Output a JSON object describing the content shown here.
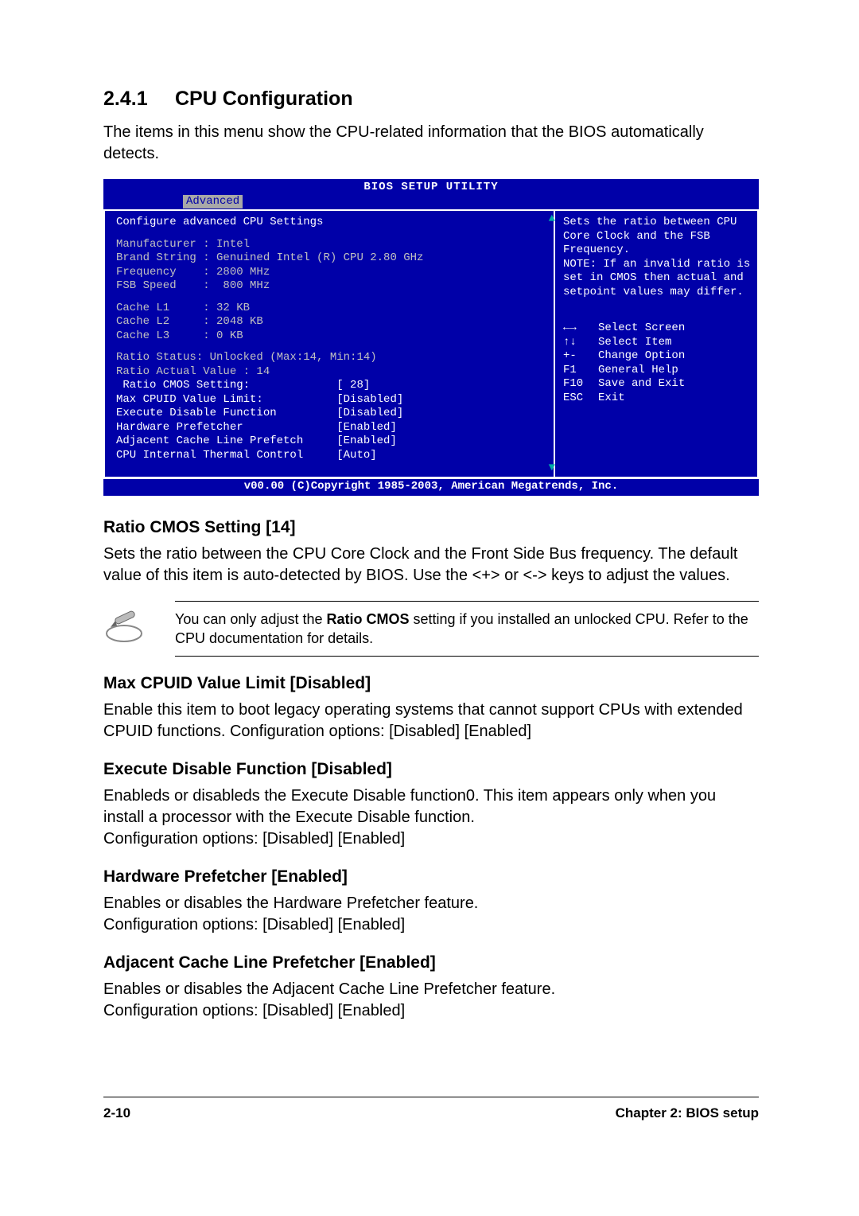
{
  "section": {
    "number": "2.4.1",
    "title": "CPU Configuration"
  },
  "intro": "The items in this menu show the CPU-related information that the BIOS automatically detects.",
  "bios": {
    "title": "BIOS SETUP UTILITY",
    "active_tab": "Advanced",
    "main_heading": "Configure advanced CPU Settings",
    "info": {
      "manufacturer": "Manufacturer : Intel",
      "brand": "Brand String : Genuined Intel (R) CPU 2.80 GHz",
      "frequency": "Frequency    : 2800 MHz",
      "fsb": "FSB Speed    :  800 MHz",
      "l1": "Cache L1     : 32 KB",
      "l2": "Cache L2     : 2048 KB",
      "l3": "Cache L3     : 0 KB"
    },
    "ratio_status": "Ratio Status: Unlocked (Max:14, Min:14)",
    "ratio_actual": "Ratio Actual Value : 14",
    "settings": {
      "ratio_cmos": " Ratio CMOS Setting:             [ 28]",
      "max_cpuid": "Max CPUID Value Limit:           [Disabled]",
      "exec_disable": "Execute Disable Function         [Disabled]",
      "hw_prefetch": "Hardware Prefetcher              [Enabled]",
      "adj_cache": "Adjacent Cache Line Prefetch     [Enabled]",
      "thermal": "CPU Internal Thermal Control     [Auto]"
    },
    "help_text": "Sets the ratio between CPU Core Clock and the FSB Frequency.\nNOTE: If an invalid ratio is set in CMOS then actual and setpoint values may differ.",
    "nav": [
      {
        "key": "←→",
        "label": "Select Screen"
      },
      {
        "key": "↑↓",
        "label": "Select Item"
      },
      {
        "key": "+-",
        "label": "Change Option"
      },
      {
        "key": "F1",
        "label": "General Help"
      },
      {
        "key": "F10",
        "label": "Save and Exit"
      },
      {
        "key": "ESC",
        "label": "Exit"
      }
    ],
    "footer": "v00.00 (C)Copyright 1985-2003, American Megatrends, Inc."
  },
  "sections": {
    "ratio": {
      "heading": "Ratio CMOS Setting [14]",
      "body": "Sets the ratio between the CPU Core Clock and the Front Side Bus frequency. The default value of this item is auto-detected by BIOS. Use the <+> or <-> keys to adjust the values."
    },
    "note": {
      "pre": "You can only adjust the ",
      "bold": "Ratio CMOS",
      "post": " setting if you installed an unlocked CPU. Refer to the CPU documentation for details."
    },
    "cpuid": {
      "heading": "Max CPUID Value Limit [Disabled]",
      "body": "Enable this item to boot legacy operating systems that cannot support CPUs with extended CPUID functions. Configuration options: [Disabled] [Enabled]"
    },
    "exec": {
      "heading": "Execute Disable Function [Disabled]",
      "body": "Enableds or disableds the Execute Disable function0. This item appears only when you install a processor with the Execute Disable function.\n Configuration options: [Disabled] [Enabled]"
    },
    "hw": {
      "heading": "Hardware Prefetcher [Enabled]",
      "body": "Enables or disables the Hardware Prefetcher feature.\nConfiguration options: [Disabled] [Enabled]"
    },
    "adj": {
      "heading": "Adjacent Cache Line Prefetcher [Enabled]",
      "body": "Enables or disables the Adjacent Cache Line  Prefetcher feature.\nConfiguration options: [Disabled] [Enabled]"
    }
  },
  "footer": {
    "left": "2-10",
    "right": "Chapter 2: BIOS setup"
  }
}
